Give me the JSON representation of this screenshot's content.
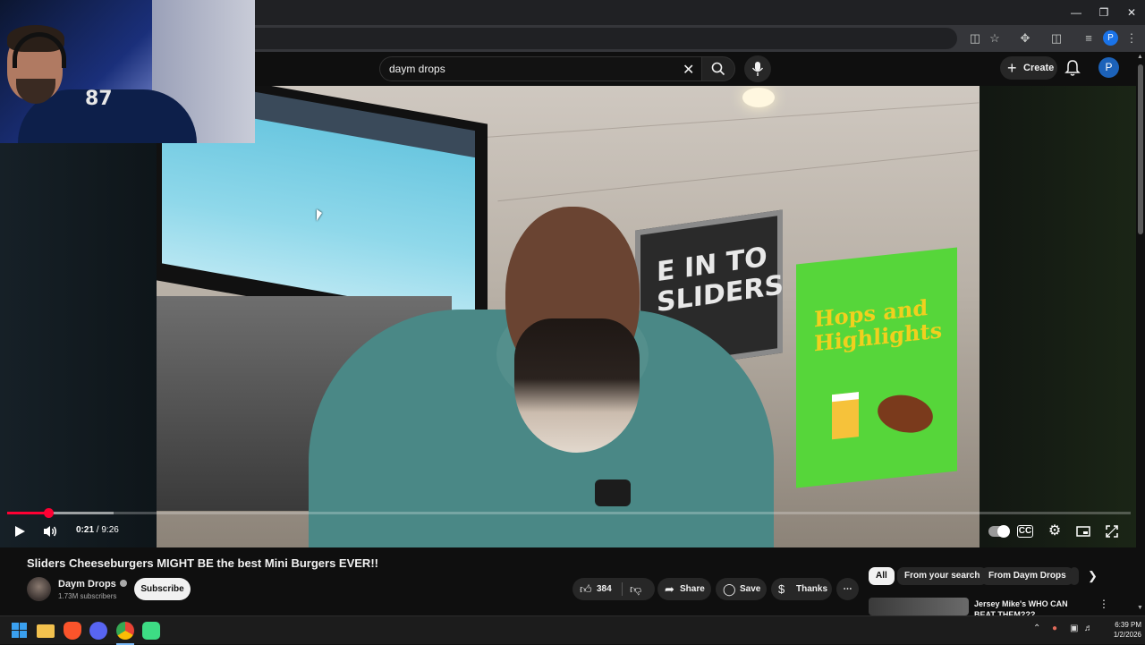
{
  "search": {
    "value": "daym drops"
  },
  "header": {
    "create_label": "Create",
    "avatar_letter": "P"
  },
  "browser": {
    "profile_letter": "P"
  },
  "webcam": {
    "jersey_number": "87"
  },
  "video_scene": {
    "sign_text": "E IN TO\nSLIDERS",
    "poster_title": "Hops and\nHighlights"
  },
  "player": {
    "time_current": "0:21",
    "time_total": "9:26",
    "progress_fraction": 0.037,
    "buffered_fraction": 0.095
  },
  "video": {
    "title": "Sliders Cheeseburgers MIGHT BE the best Mini Burgers EVER!!",
    "channel": "Daym Drops",
    "subscribers": "1.73M subscribers",
    "subscribe_label": "Subscribe",
    "likes": "384",
    "share_label": "Share",
    "save_label": "Save",
    "thanks_label": "Thanks"
  },
  "chips": [
    "All",
    "From your search",
    "From Daym Drops"
  ],
  "recommendation": {
    "title": "Jersey Mike's WHO CAN BEAT THEM???"
  },
  "taskbar": {
    "time": "6:39 PM",
    "date": "1/2/2026"
  },
  "colors": {
    "accent": "#ff0033",
    "subscribe_bg": "#f1f1f1"
  }
}
